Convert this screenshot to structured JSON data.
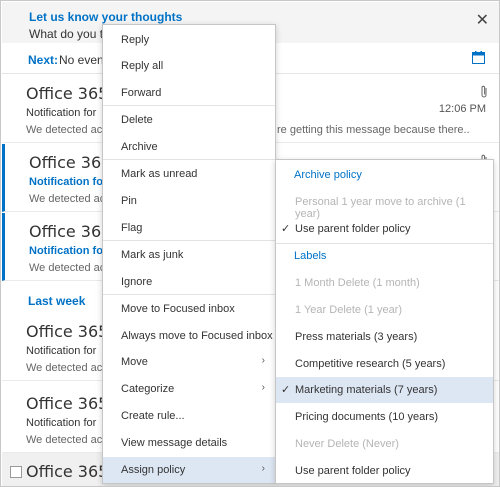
{
  "feedback": {
    "title": "Let us know your thoughts",
    "subtitle": "What do you th",
    "close_icon": "close-icon"
  },
  "next": {
    "label": "Next:",
    "value": "No events"
  },
  "messages": [
    {
      "sender": "Office 365 A",
      "subject": "Notification for",
      "preview": "We detected act",
      "preview_tail": "",
      "time": "",
      "unread": false
    },
    {
      "sender": "Office 365 A",
      "subject": "Notification for",
      "preview": "We detected act",
      "preview_tail": "re getting this message because there..",
      "time": "12:06 PM",
      "unread": false
    },
    {
      "sender": "Office 365 A",
      "subject": "Notification for",
      "preview": "We detected act",
      "preview_tail": "",
      "time": "",
      "unread": true
    },
    {
      "sender": "Office 365 A",
      "subject": "Notification for",
      "preview": "We detected act",
      "preview_tail": "",
      "time": "",
      "unread": true
    },
    {
      "sender": "Office 365 A",
      "subject": "Notification for",
      "preview": "We detected act",
      "preview_tail": "",
      "time": "",
      "unread": false
    },
    {
      "sender": "Office 365 A",
      "subject": "Notification for",
      "preview": "We detected act",
      "preview_tail": "",
      "time": "",
      "unread": false
    },
    {
      "sender": "Office 365 A",
      "subject": "",
      "preview": "",
      "preview_tail": "",
      "time": "",
      "unread": false
    }
  ],
  "section_label": "Last week",
  "context_menu": {
    "items": [
      "Reply",
      "Reply all",
      "Forward",
      "Delete",
      "Archive",
      "Mark as unread",
      "Pin",
      "Flag",
      "Mark as junk",
      "Ignore",
      "Move to Focused inbox",
      "Always move to Focused inbox",
      "Move",
      "Categorize",
      "Create rule...",
      "View message details",
      "Assign policy"
    ],
    "submenu_arrow": "›"
  },
  "policy_menu": {
    "archive_header": "Archive policy",
    "archive_items": [
      {
        "label": "Personal 1 year move to archive (1 year)",
        "disabled": true,
        "checked": false
      },
      {
        "label": "Use parent folder policy",
        "disabled": false,
        "checked": true
      }
    ],
    "labels_header": "Labels",
    "label_items": [
      {
        "label": "1 Month Delete (1 month)",
        "disabled": true,
        "checked": false
      },
      {
        "label": "1 Year Delete (1 year)",
        "disabled": true,
        "checked": false
      },
      {
        "label": "Press materials (3 years)",
        "disabled": false,
        "checked": false
      },
      {
        "label": "Competitive research (5 years)",
        "disabled": false,
        "checked": false
      },
      {
        "label": "Marketing materials (7 years)",
        "disabled": false,
        "checked": true
      },
      {
        "label": "Pricing documents (10 years)",
        "disabled": false,
        "checked": false
      },
      {
        "label": "Never Delete (Never)",
        "disabled": true,
        "checked": false
      },
      {
        "label": "Use parent folder policy",
        "disabled": false,
        "checked": false
      }
    ],
    "check_glyph": "✓"
  },
  "colors": {
    "accent": "#0072c6",
    "highlight": "#dde7f3",
    "disabled_text": "#b5b5b5"
  }
}
